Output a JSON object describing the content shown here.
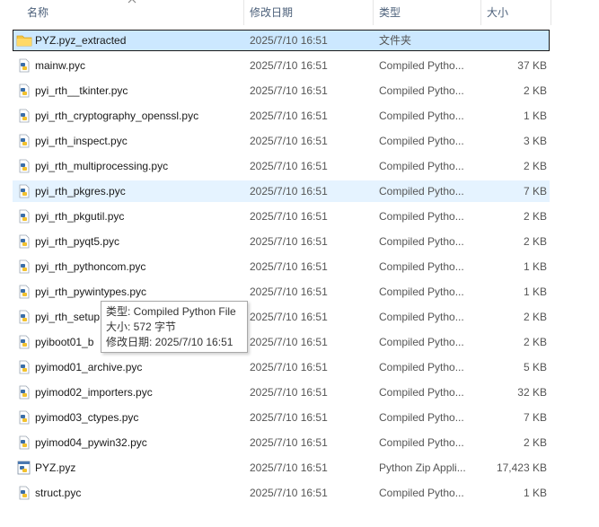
{
  "header": {
    "name": "名称",
    "date": "修改日期",
    "type": "类型",
    "size": "大小"
  },
  "rows": [
    {
      "name": "PYZ.pyz_extracted",
      "date": "2025/7/10 16:51",
      "type": "文件夹",
      "size": "",
      "icon": "folder-icon"
    },
    {
      "name": "mainw.pyc",
      "date": "2025/7/10 16:51",
      "type": "Compiled Pytho...",
      "size": "37 KB",
      "icon": "pyc-file-icon"
    },
    {
      "name": "pyi_rth__tkinter.pyc",
      "date": "2025/7/10 16:51",
      "type": "Compiled Pytho...",
      "size": "2 KB",
      "icon": "pyc-file-icon"
    },
    {
      "name": "pyi_rth_cryptography_openssl.pyc",
      "date": "2025/7/10 16:51",
      "type": "Compiled Pytho...",
      "size": "1 KB",
      "icon": "pyc-file-icon"
    },
    {
      "name": "pyi_rth_inspect.pyc",
      "date": "2025/7/10 16:51",
      "type": "Compiled Pytho...",
      "size": "3 KB",
      "icon": "pyc-file-icon"
    },
    {
      "name": "pyi_rth_multiprocessing.pyc",
      "date": "2025/7/10 16:51",
      "type": "Compiled Pytho...",
      "size": "2 KB",
      "icon": "pyc-file-icon"
    },
    {
      "name": "pyi_rth_pkgres.pyc",
      "date": "2025/7/10 16:51",
      "type": "Compiled Pytho...",
      "size": "7 KB",
      "icon": "pyc-file-icon"
    },
    {
      "name": "pyi_rth_pkgutil.pyc",
      "date": "2025/7/10 16:51",
      "type": "Compiled Pytho...",
      "size": "2 KB",
      "icon": "pyc-file-icon"
    },
    {
      "name": "pyi_rth_pyqt5.pyc",
      "date": "2025/7/10 16:51",
      "type": "Compiled Pytho...",
      "size": "2 KB",
      "icon": "pyc-file-icon"
    },
    {
      "name": "pyi_rth_pythoncom.pyc",
      "date": "2025/7/10 16:51",
      "type": "Compiled Pytho...",
      "size": "1 KB",
      "icon": "pyc-file-icon"
    },
    {
      "name": "pyi_rth_pywintypes.pyc",
      "date": "2025/7/10 16:51",
      "type": "Compiled Pytho...",
      "size": "1 KB",
      "icon": "pyc-file-icon"
    },
    {
      "name": "pyi_rth_setup",
      "date": "2025/7/10 16:51",
      "type": "Compiled Pytho...",
      "size": "2 KB",
      "icon": "pyc-file-icon"
    },
    {
      "name": "pyiboot01_b",
      "date": "2025/7/10 16:51",
      "type": "Compiled Pytho...",
      "size": "2 KB",
      "icon": "pyc-file-icon"
    },
    {
      "name": "pyimod01_archive.pyc",
      "date": "2025/7/10 16:51",
      "type": "Compiled Pytho...",
      "size": "5 KB",
      "icon": "pyc-file-icon"
    },
    {
      "name": "pyimod02_importers.pyc",
      "date": "2025/7/10 16:51",
      "type": "Compiled Pytho...",
      "size": "32 KB",
      "icon": "pyc-file-icon"
    },
    {
      "name": "pyimod03_ctypes.pyc",
      "date": "2025/7/10 16:51",
      "type": "Compiled Pytho...",
      "size": "7 KB",
      "icon": "pyc-file-icon"
    },
    {
      "name": "pyimod04_pywin32.pyc",
      "date": "2025/7/10 16:51",
      "type": "Compiled Pytho...",
      "size": "2 KB",
      "icon": "pyc-file-icon"
    },
    {
      "name": "PYZ.pyz",
      "date": "2025/7/10 16:51",
      "type": "Python Zip Appli...",
      "size": "17,423 KB",
      "icon": "pyz-file-icon"
    },
    {
      "name": "struct.pyc",
      "date": "2025/7/10 16:51",
      "type": "Compiled Pytho...",
      "size": "1 KB",
      "icon": "pyc-file-icon"
    }
  ],
  "tooltip": {
    "type_line": "类型: Compiled Python File",
    "size_line": "大小: 572 字节",
    "date_line": "修改日期: 2025/7/10 16:51"
  },
  "colors": {
    "selected_bg": "#cce8ff",
    "hover_bg": "#e5f3ff",
    "folder": "#f4c542",
    "header_text": "#4c607a"
  }
}
